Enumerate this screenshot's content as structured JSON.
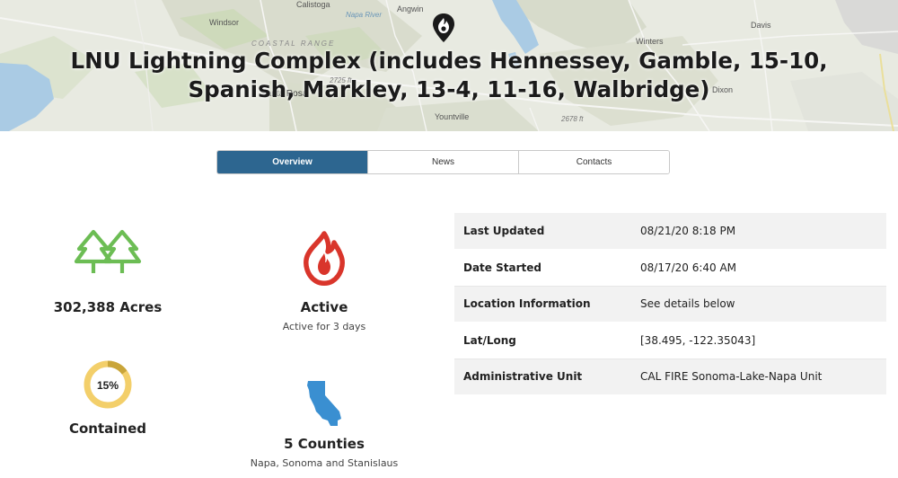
{
  "map": {
    "labels": {
      "calistoga": "Calistoga",
      "angwin": "Angwin",
      "windsor": "Windsor",
      "napa_river": "Napa River",
      "coastal_range": "COASTAL RANGE",
      "santa_rosa": "Santa Rosa",
      "yountville": "Yountville",
      "elev_1": "2725 ft",
      "elev_2": "2678 ft",
      "winters": "Winters",
      "davis": "Davis",
      "dixon": "Dixon"
    },
    "pin_icon": "fire-location-pin-icon"
  },
  "incident": {
    "title": "LNU Lightning Complex (includes Hennessey, Gamble, 15-10, Spanish, Markley, 13-4, 11-16, Walbridge)"
  },
  "tabs": [
    {
      "label": "Overview",
      "active": true
    },
    {
      "label": "News",
      "active": false
    },
    {
      "label": "Contacts",
      "active": false
    }
  ],
  "stats": {
    "acres": {
      "icon": "trees-icon",
      "label": "302,388 Acres"
    },
    "status": {
      "icon": "fire-icon",
      "label": "Active",
      "sub": "Active for 3 days"
    },
    "containment": {
      "icon": "containment-donut",
      "percent_label": "15%",
      "percent": 15,
      "label": "Contained"
    },
    "counties": {
      "icon": "california-map-icon",
      "label": "5 Counties",
      "sub": "Napa, Sonoma and Stanislaus"
    }
  },
  "info": {
    "rows": [
      {
        "key": "Last Updated",
        "value": "08/21/20 8:18 PM"
      },
      {
        "key": "Date Started",
        "value": "08/17/20 6:40 AM"
      },
      {
        "key": "Location Information",
        "value": "See details below"
      },
      {
        "key": "Lat/Long",
        "value": "[38.495, -122.35043]"
      },
      {
        "key": "Administrative Unit",
        "value": "CAL FIRE Sonoma-Lake-Napa Unit"
      }
    ]
  },
  "colors": {
    "tab_active": "#2d6690",
    "trees_green": "#6cbd54",
    "fire_red": "#d9352b",
    "donut_yellow": "#f3cf6a",
    "donut_dark": "#c9a53a",
    "california_blue": "#3a8fd1"
  }
}
